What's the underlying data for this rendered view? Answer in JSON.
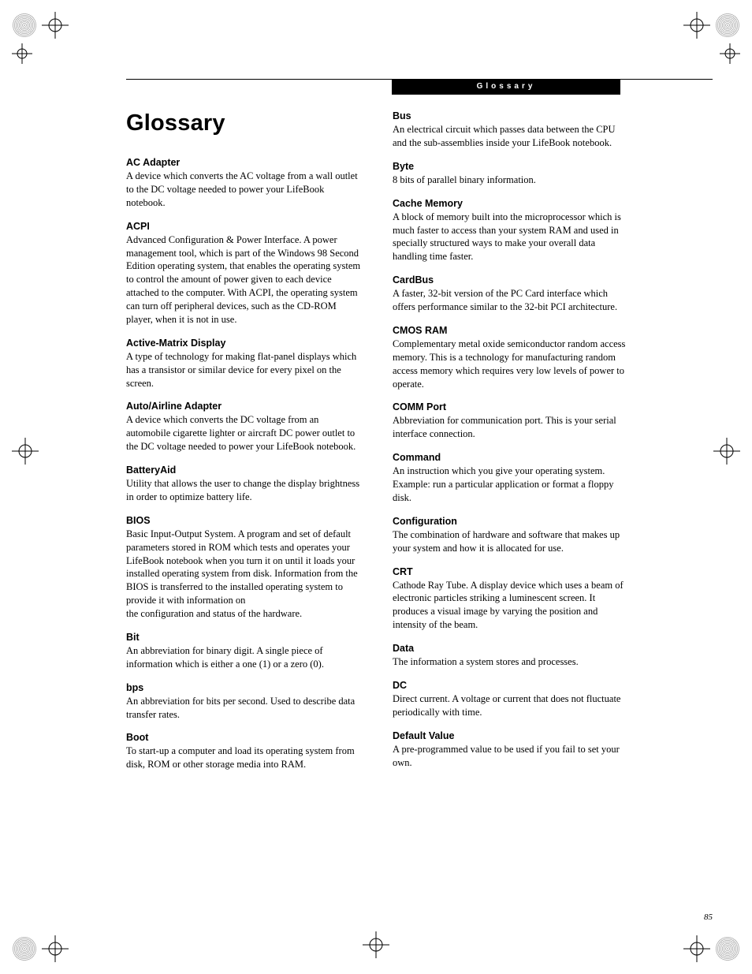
{
  "section_header": "Glossary",
  "title": "Glossary",
  "page_number": "85",
  "left": [
    {
      "term": "AC Adapter",
      "def": "A device which converts the AC voltage from a wall outlet to the DC voltage needed to power your LifeBook notebook."
    },
    {
      "term": "ACPI",
      "def": "Advanced Configuration & Power Interface. A power management tool, which is part of the Windows 98 Second Edition operating system, that enables the operating system to control the amount of power given to each device attached to the computer. With ACPI, the operating system can turn off peripheral devices, such as the CD-ROM player, when it is not in use."
    },
    {
      "term": "Active-Matrix Display",
      "def": "A type of technology for making flat-panel displays which has a transistor or similar device for every pixel on the screen."
    },
    {
      "term": "Auto/Airline Adapter",
      "def": "A device which converts the DC voltage from an automobile cigarette lighter or aircraft DC power outlet to the DC voltage needed to power your LifeBook notebook."
    },
    {
      "term": "BatteryAid",
      "def": "Utility that allows the user to change the display brightness in order to optimize battery life."
    },
    {
      "term": "BIOS",
      "def": "Basic Input-Output System. A program and set of default parameters stored in ROM which tests and operates your LifeBook notebook when you turn it on until it loads your installed operating system from disk. Information from the BIOS is transferred to the installed operating system to provide it with information on\nthe configuration and status of the hardware."
    },
    {
      "term": "Bit",
      "def": "An abbreviation for binary digit. A single piece of information which is either a one (1) or a zero (0)."
    },
    {
      "term": "bps",
      "def": "An abbreviation for bits per second. Used to describe data transfer rates."
    },
    {
      "term": "Boot",
      "def": "To start-up a computer and load its operating system from disk, ROM or other storage media into RAM."
    }
  ],
  "right": [
    {
      "term": "Bus",
      "def": "An electrical circuit which passes data between the CPU and the sub-assemblies inside your LifeBook notebook."
    },
    {
      "term": "Byte",
      "def": "8 bits of parallel binary information."
    },
    {
      "term": "Cache Memory",
      "def": "A block of memory built into the microprocessor which is much faster to access than your system RAM and used in specially structured ways to make your overall data handling time faster."
    },
    {
      "term": "CardBus",
      "def": "A faster, 32-bit version of the PC Card interface which offers performance similar to the 32-bit PCI architecture."
    },
    {
      "term": "CMOS RAM",
      "def": "Complementary metal oxide semiconductor random access memory. This is a technology for manufacturing random access memory which requires very low levels of power to operate."
    },
    {
      "term": "COMM Port",
      "def": "Abbreviation for communication port. This is your serial interface connection."
    },
    {
      "term": "Command",
      "def": "An instruction which you give your operating system. Example: run a particular application or format a floppy disk."
    },
    {
      "term": "Configuration",
      "def": "The combination of hardware and software that makes up your system and how it is allocated for use."
    },
    {
      "term": "CRT",
      "def": "Cathode Ray Tube. A display device which uses a beam of electronic particles striking a luminescent screen. It produces a visual image by varying the position and intensity of the beam."
    },
    {
      "term": "Data",
      "def": "The information a system stores and processes."
    },
    {
      "term": "DC",
      "def": "Direct current. A voltage or current that does not fluctuate periodically with time."
    },
    {
      "term": "Default Value",
      "def": "A pre-programmed value to be used if you fail to set your own."
    }
  ]
}
